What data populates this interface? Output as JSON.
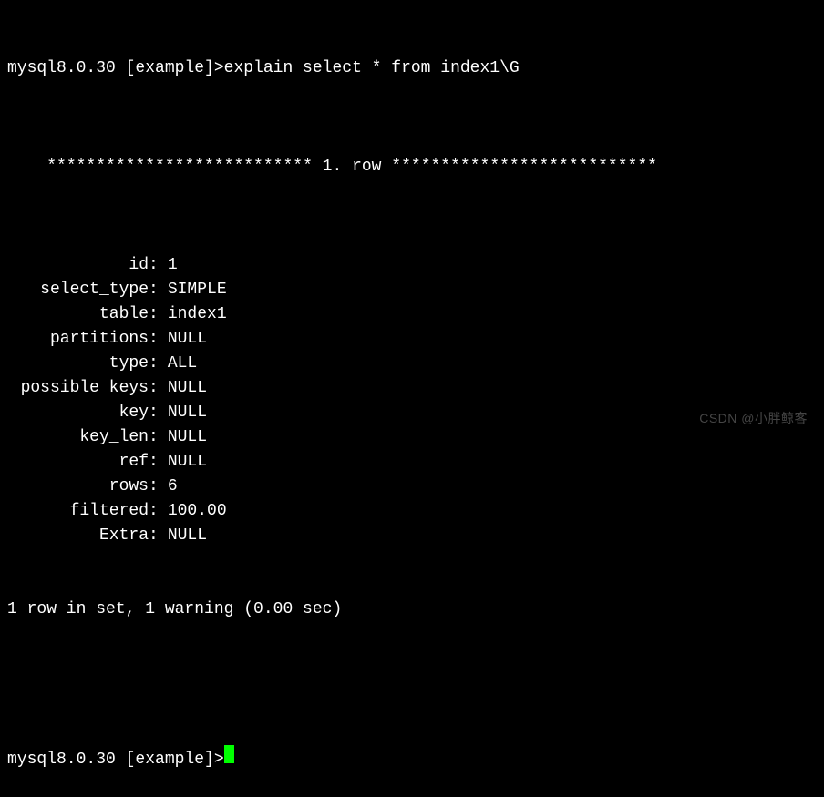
{
  "prompt1": {
    "prefix": "mysql8.0.30 [example]>",
    "command": "explain select * from index1\\G"
  },
  "separator": {
    "stars_left": "***************************",
    "row_label": " 1. row ",
    "stars_right": "***************************"
  },
  "fields": [
    {
      "label": "id",
      "value": "1"
    },
    {
      "label": "select_type",
      "value": "SIMPLE"
    },
    {
      "label": "table",
      "value": "index1"
    },
    {
      "label": "partitions",
      "value": "NULL"
    },
    {
      "label": "type",
      "value": "ALL"
    },
    {
      "label": "possible_keys",
      "value": "NULL"
    },
    {
      "label": "key",
      "value": "NULL"
    },
    {
      "label": "key_len",
      "value": "NULL"
    },
    {
      "label": "ref",
      "value": "NULL"
    },
    {
      "label": "rows",
      "value": "6"
    },
    {
      "label": "filtered",
      "value": "100.00"
    },
    {
      "label": "Extra",
      "value": "NULL"
    }
  ],
  "summary": "1 row in set, 1 warning (0.00 sec)",
  "prompt2": {
    "prefix": "mysql8.0.30 [example]>"
  },
  "watermark": "CSDN @小胖鲸客"
}
